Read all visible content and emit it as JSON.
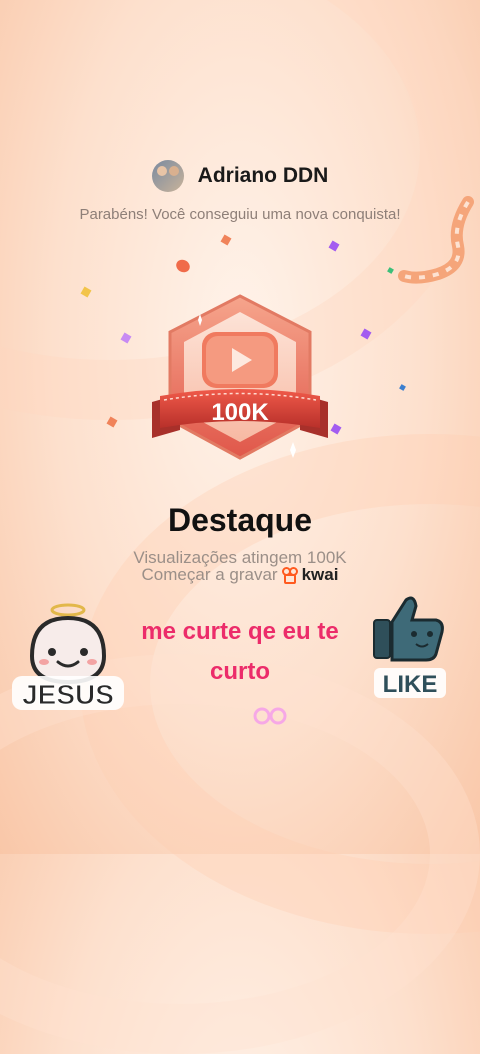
{
  "user": {
    "name": "Adriano DDN"
  },
  "congrats_text": "Parabéns! Você conseguiu uma nova conquista!",
  "badge": {
    "label": "100K"
  },
  "achievement": {
    "title": "Destaque",
    "description": "Visualizações atingem 100K",
    "record_text": "Começar a gravar",
    "brand": "kwai"
  },
  "caption": {
    "line1": "me curte qe eu te",
    "line2": "curto"
  },
  "stickers": {
    "jesus": "JESUS",
    "like": "LIKE"
  },
  "colors": {
    "caption": "#ec2c6a",
    "badge": "#d9463f",
    "brand": "#ff5a1f"
  }
}
